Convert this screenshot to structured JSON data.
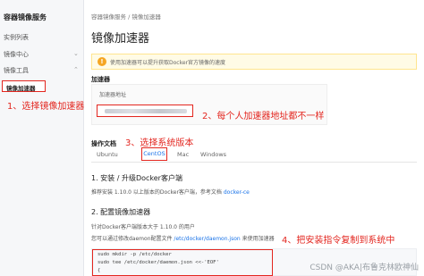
{
  "sidebar": {
    "title": "容器镜像服务",
    "items": [
      {
        "label": "实例列表",
        "chevron": false
      },
      {
        "label": "镜像中心",
        "chevron": true
      },
      {
        "label": "镜像工具",
        "chevron": true
      }
    ],
    "active_item": "镜像加速器"
  },
  "header": {
    "breadcrumb": "容器镜像服务  /  镜像加速器",
    "title": "镜像加速器"
  },
  "notice": {
    "icon": "info-icon",
    "text": "使用加速器可以提升获取Docker官方镜像的速度"
  },
  "accelerator": {
    "section_label": "加速器",
    "address_label": "加速器地址"
  },
  "docs": {
    "section_label": "操作文档",
    "tabs": [
      "Ubuntu",
      "CentOS",
      "Mac",
      "Windows"
    ],
    "active_tab": "CentOS",
    "step1_title": "1. 安装 / 升级Docker客户端",
    "step1_text_prefix": "推荐安装 1.10.0 以上版本的Docker客户端，参考文档",
    "step1_link": "docker-ce",
    "step2_title": "2. 配置镜像加速器",
    "step2_text1": "针对Docker客户端版本大于 1.10.0 的用户",
    "step2_text2_prefix": "您可以通过修改daemon配置文件",
    "step2_text2_link": "/etc/docker/daemon.json",
    "step2_text2_suffix": "来使用加速器",
    "code_lines": [
      "sudo mkdir -p /etc/docker",
      "sudo tee /etc/docker/daemon.json <<-'EOF'",
      "{"
    ]
  },
  "annotations": {
    "a1": "1、选择镜像加速器",
    "a2": "2、每个人加速器地址都不一样",
    "a3": "3、选择系统版本",
    "a4": "4、把安装指令复制到系统中"
  },
  "watermark": "CSDN @AKA|布鲁克林欧神仙",
  "colors": {
    "highlight": "#e3261f",
    "link": "#1a73e8",
    "notice_bg": "#fffbe6"
  }
}
